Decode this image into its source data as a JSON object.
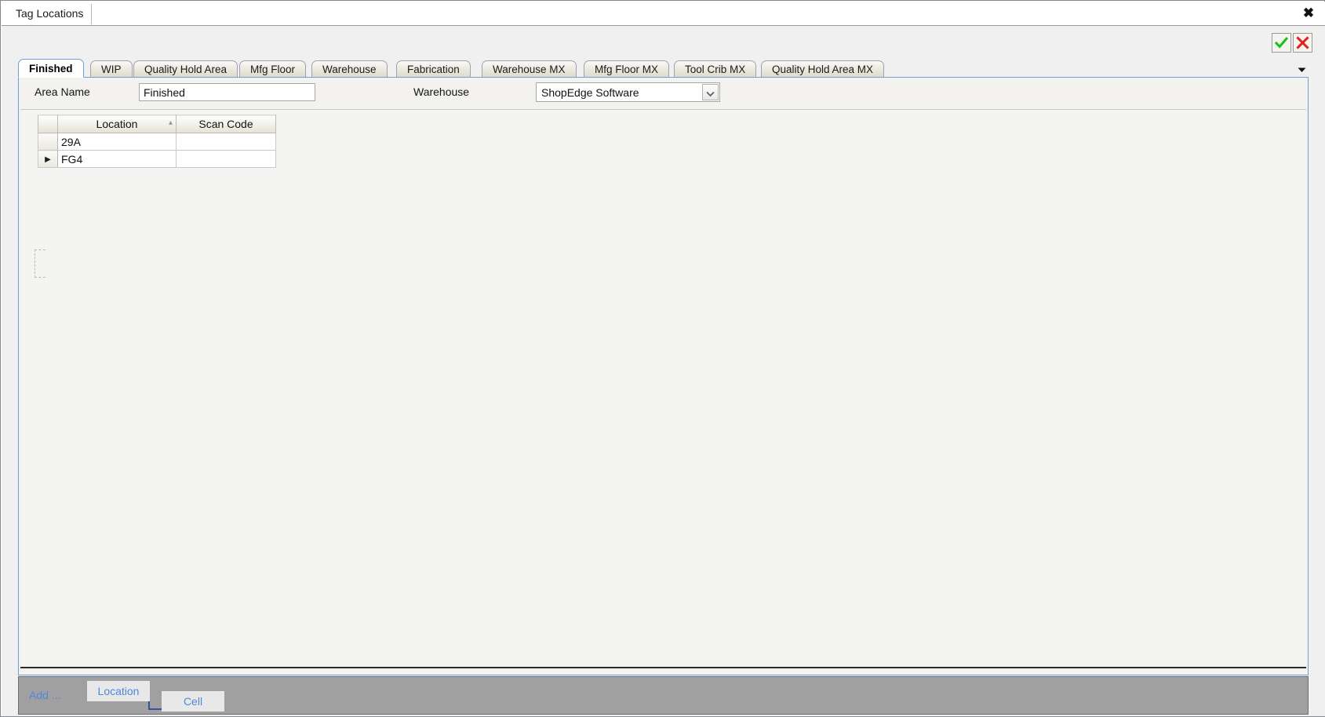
{
  "window": {
    "document_tab": "Tag Locations",
    "close_label": "✖"
  },
  "confirm": {
    "ok_name": "check-icon",
    "cancel_name": "cross-icon",
    "ok_color": "#17c217",
    "cancel_color": "#e02020"
  },
  "tabs": [
    {
      "label": "Finished",
      "active": true
    },
    {
      "label": "WIP",
      "active": false
    },
    {
      "label": "Quality Hold Area",
      "active": false
    },
    {
      "label": "Mfg Floor",
      "active": false
    },
    {
      "label": "Warehouse",
      "active": false
    },
    {
      "label": "Fabrication",
      "active": false
    },
    {
      "label": "Warehouse MX",
      "active": false
    },
    {
      "label": "Mfg Floor MX",
      "active": false
    },
    {
      "label": "Tool Crib MX",
      "active": false
    },
    {
      "label": "Quality Hold Area MX",
      "active": false
    }
  ],
  "form": {
    "area_name_label": "Area Name",
    "area_name_value": "Finished",
    "warehouse_label": "Warehouse",
    "warehouse_value": "ShopEdge Software"
  },
  "grid": {
    "columns": [
      "Location",
      "Scan Code"
    ],
    "sort_column": "Location",
    "sort_direction": "ascending",
    "rows": [
      {
        "selector": "",
        "location": "29A",
        "scan_code": ""
      },
      {
        "selector": "▶",
        "location": "FG4",
        "scan_code": ""
      }
    ]
  },
  "action_bar": {
    "add_label": "Add ...",
    "location_button": "Location",
    "cell_button": "Cell"
  }
}
